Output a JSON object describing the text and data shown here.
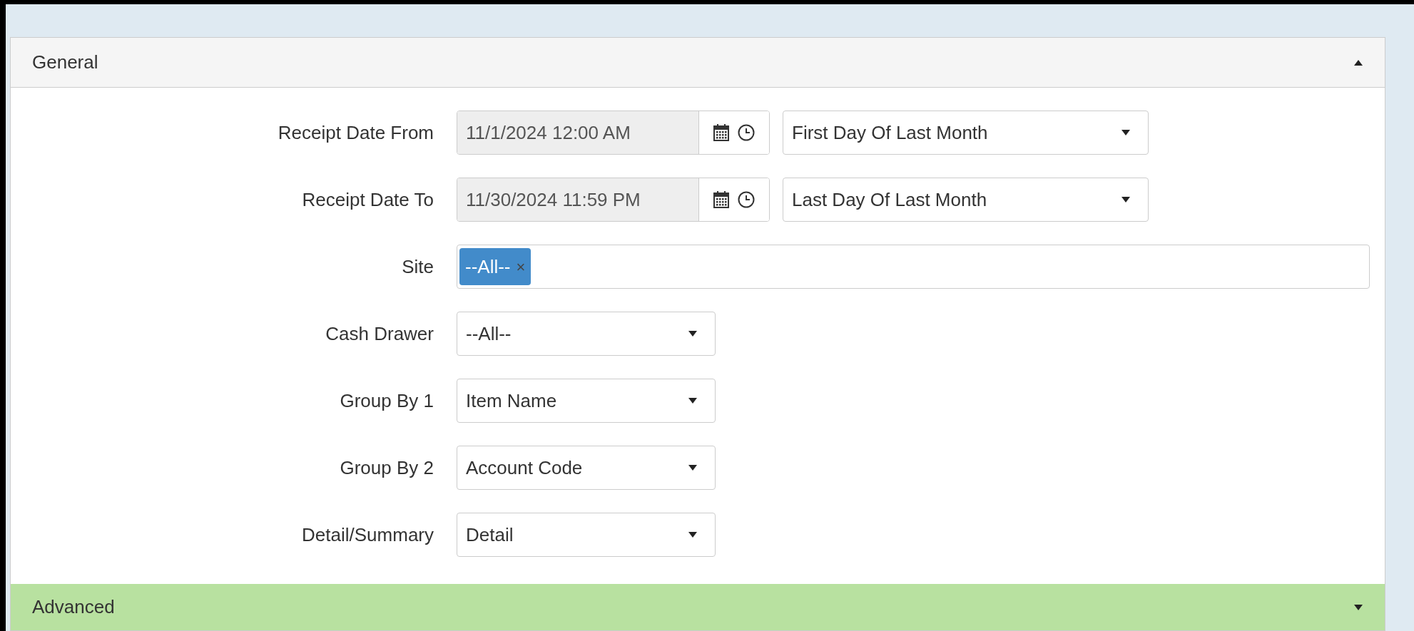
{
  "sections": [
    {
      "title": "General",
      "expanded": true,
      "fields": [
        {
          "kind": "datetime",
          "label": "Receipt Date From",
          "value": "11/1/2024 12:00 AM",
          "preset": "First Day Of Last Month"
        },
        {
          "kind": "datetime",
          "label": "Receipt Date To",
          "value": "11/30/2024 11:59 PM",
          "preset": "Last Day Of Last Month"
        },
        {
          "kind": "tags",
          "label": "Site",
          "tags": [
            {
              "label": "--All--",
              "remove": "×"
            }
          ]
        },
        {
          "kind": "select",
          "label": "Cash Drawer",
          "value": "--All--"
        },
        {
          "kind": "select",
          "label": "Group By 1",
          "value": "Item Name"
        },
        {
          "kind": "select",
          "label": "Group By 2",
          "value": "Account Code"
        },
        {
          "kind": "select",
          "label": "Detail/Summary",
          "value": "Detail"
        }
      ]
    },
    {
      "title": "Advanced",
      "expanded": false
    }
  ]
}
